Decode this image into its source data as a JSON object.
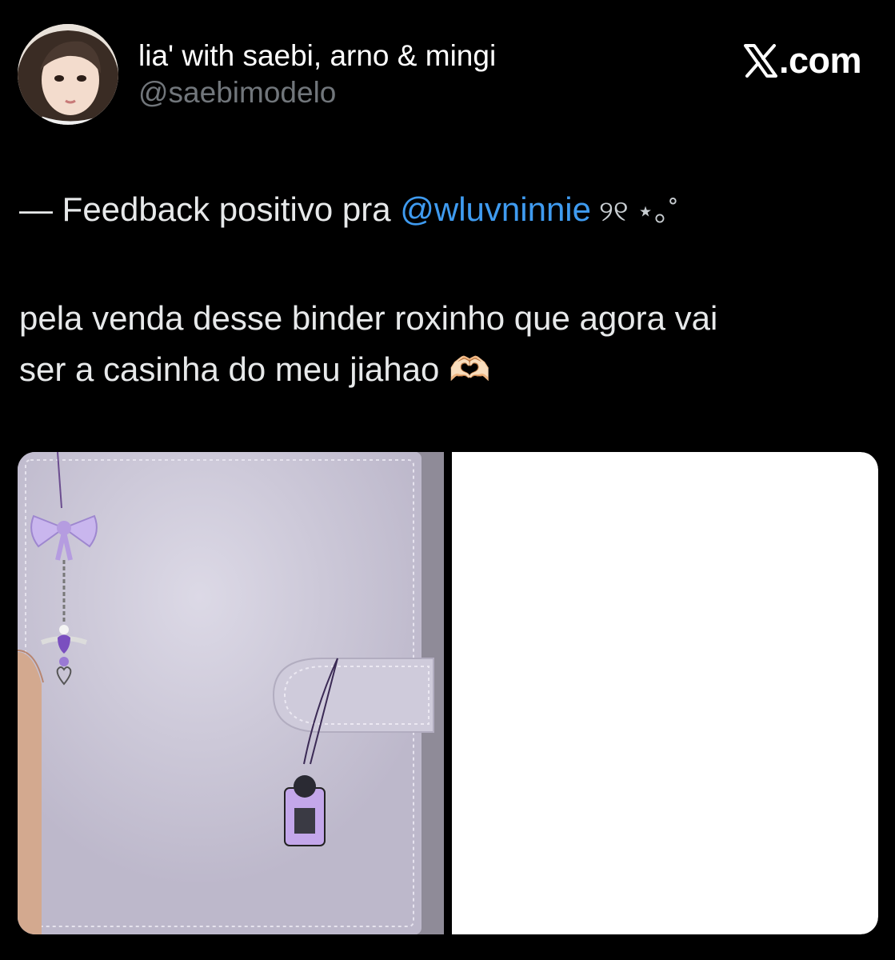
{
  "author": {
    "display_name": "lia' with saebi, arno & mingi",
    "handle": "@saebimodelo",
    "avatar_icon": "profile-photo"
  },
  "site": {
    "logo_icon": "x-logo-icon",
    "suffix": ".com"
  },
  "tweet": {
    "line1_prefix": "— Feedback positivo pra ",
    "mention": "@wluvninnie",
    "line1_suffix": " ୨୧ ⋆｡˚",
    "line2": "pela venda desse binder roxinho que agora vai",
    "line3": "ser a casinha do meu jiahao 🫶🏻"
  },
  "media": {
    "photo_icon": "binder-photo",
    "second_panel_icon": "blank-image"
  },
  "colors": {
    "background": "#000000",
    "text": "#e7e9ea",
    "secondary_text": "#71767b",
    "mention": "#3f9bf0",
    "binder": "#c9c5d3"
  }
}
